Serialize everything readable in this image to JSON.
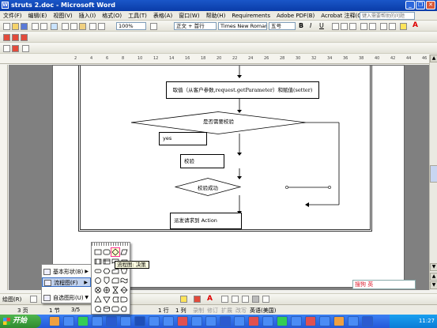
{
  "window": {
    "title": "struts 2.doc - Microsoft Word"
  },
  "menubar": {
    "items": [
      "文件(F)",
      "编辑(E)",
      "视图(V)",
      "插入(I)",
      "格式(O)",
      "工具(T)",
      "表格(A)",
      "窗口(W)",
      "帮助(H)",
      "Requirements",
      "Adobe PDF(B)",
      "Acrobat 注释(C)"
    ],
    "help_placeholder": "键入需要帮助的问题"
  },
  "toolbar": {
    "zoom": "100%",
    "style": "正文 + 首行",
    "font": "Times New Roman",
    "size": "五号"
  },
  "ruler": {
    "ticks": [
      "2",
      "4",
      "6",
      "8",
      "10",
      "12",
      "14",
      "16",
      "18",
      "20",
      "22",
      "24",
      "26",
      "28",
      "30",
      "32",
      "34",
      "36",
      "38",
      "40",
      "42",
      "44",
      "46"
    ]
  },
  "flowchart": {
    "box_get": "取值（从客户参数,request.getParameter）和赋值(setter)",
    "diamond_validate_q": "是否需要校验",
    "label_yes": "yes",
    "box_validate": "校验",
    "diamond_success": "校验成功",
    "box_dispatch": "派发请求到 Action"
  },
  "autoshape_menu": {
    "items": [
      {
        "label": "基本形状(B)",
        "arrow": "▶"
      },
      {
        "label": "流程图(F)",
        "arrow": "▶"
      },
      {
        "label": "自选图形(U)",
        "arrow": "▼"
      }
    ],
    "draw_label": "绘图(R)"
  },
  "tooltip": "流程图: 决策",
  "sogou": {
    "text": "搜狗 英"
  },
  "status": {
    "page": "3 页",
    "section": "1 节",
    "pages": "3/5",
    "line": "1 行",
    "col": "1 列",
    "rec": "录制",
    "trk": "修订",
    "ext": "扩展",
    "ovr": "改写",
    "lang": "英语(美国)"
  },
  "taskbar": {
    "start": "开始",
    "clock": "11:27"
  }
}
